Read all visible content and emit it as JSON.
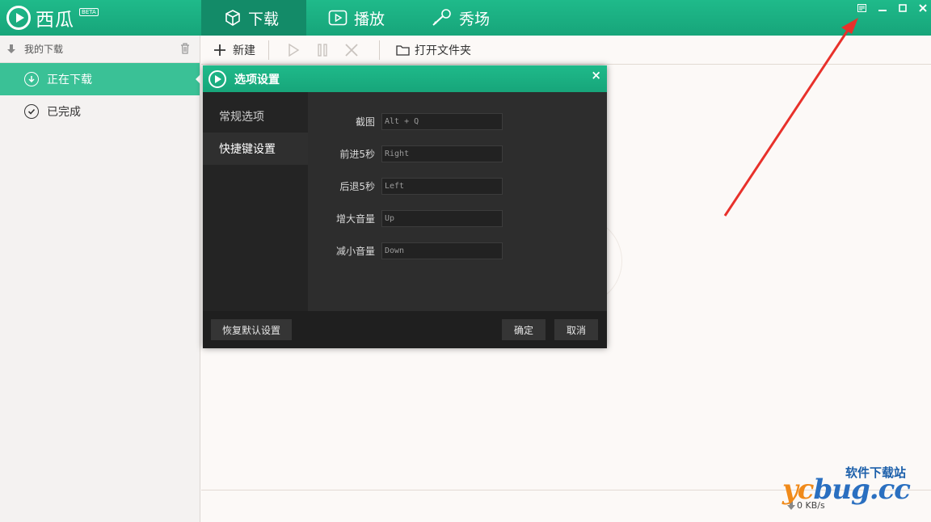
{
  "app": {
    "name": "西瓜",
    "badge": "BETA"
  },
  "nav": {
    "tabs": [
      {
        "label": "下载"
      },
      {
        "label": "播放"
      },
      {
        "label": "秀场"
      }
    ]
  },
  "sidebar": {
    "header": "我的下载",
    "items": [
      {
        "label": "正在下载"
      },
      {
        "label": "已完成"
      }
    ]
  },
  "toolbar": {
    "new_label": "新建",
    "open_folder_label": "打开文件夹"
  },
  "status": {
    "speed": "0 KB/s"
  },
  "dialog": {
    "title": "选项设置",
    "close": "×",
    "nav": [
      {
        "label": "常规选项"
      },
      {
        "label": "快捷键设置"
      }
    ],
    "shortcuts": [
      {
        "label": "截图",
        "value": "Alt + Q"
      },
      {
        "label": "前进5秒",
        "value": "Right"
      },
      {
        "label": "后退5秒",
        "value": "Left"
      },
      {
        "label": "增大音量",
        "value": "Up"
      },
      {
        "label": "减小音量",
        "value": "Down"
      }
    ],
    "restore_label": "恢复默认设置",
    "ok_label": "确定",
    "cancel_label": "取消"
  },
  "watermark": {
    "top": "软件下载站",
    "main_a": "yc",
    "main_b": "bug.cc"
  },
  "colors": {
    "brand": "#1fba8a",
    "active_item": "#3ac196",
    "arrow": "#e8312b"
  }
}
